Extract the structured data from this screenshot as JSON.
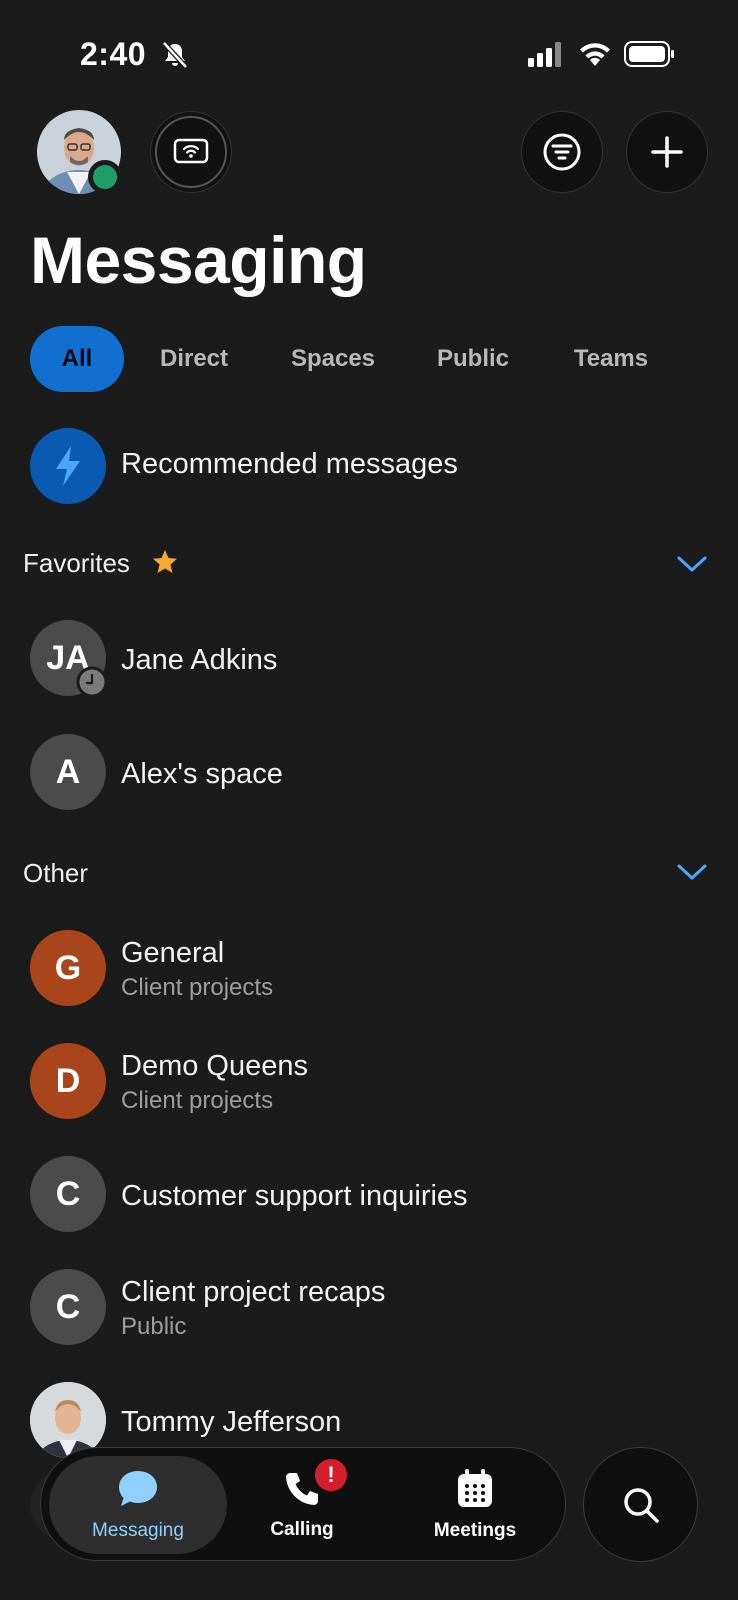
{
  "status_bar": {
    "time": "2:40"
  },
  "header": {
    "title": "Messaging",
    "presence_color": "#1f9e67"
  },
  "tabs": [
    {
      "label": "All",
      "active": true
    },
    {
      "label": "Direct"
    },
    {
      "label": "Spaces"
    },
    {
      "label": "Public"
    },
    {
      "label": "Teams"
    }
  ],
  "recommended": {
    "label": "Recommended messages",
    "icon": "lightning-icon"
  },
  "favorites": {
    "label": "Favorites",
    "items": [
      {
        "initials": "JA",
        "name": "Jane Adkins",
        "status_icon": "clock-icon"
      },
      {
        "initials": "A",
        "name": "Alex's space"
      }
    ]
  },
  "other": {
    "label": "Other",
    "items": [
      {
        "initials": "G",
        "name": "General",
        "subtitle": "Client projects",
        "color": "#a8451a"
      },
      {
        "initials": "D",
        "name": "Demo Queens",
        "subtitle": "Client projects",
        "color": "#a8451a"
      },
      {
        "initials": "C",
        "name": "Customer support inquiries",
        "color": "#4b4b4b"
      },
      {
        "initials": "C",
        "name": "Client project recaps",
        "subtitle": "Public",
        "color": "#4b4b4b"
      },
      {
        "name": "Tommy Jefferson"
      }
    ]
  },
  "bottom_nav": {
    "items": [
      {
        "label": "Messaging",
        "icon": "chat-bubble-icon",
        "active": true
      },
      {
        "label": "Calling",
        "icon": "phone-icon",
        "badge": "!"
      },
      {
        "label": "Meetings",
        "icon": "calendar-icon"
      }
    ],
    "search_icon": "search-icon"
  },
  "accent_color": "#1170cf"
}
